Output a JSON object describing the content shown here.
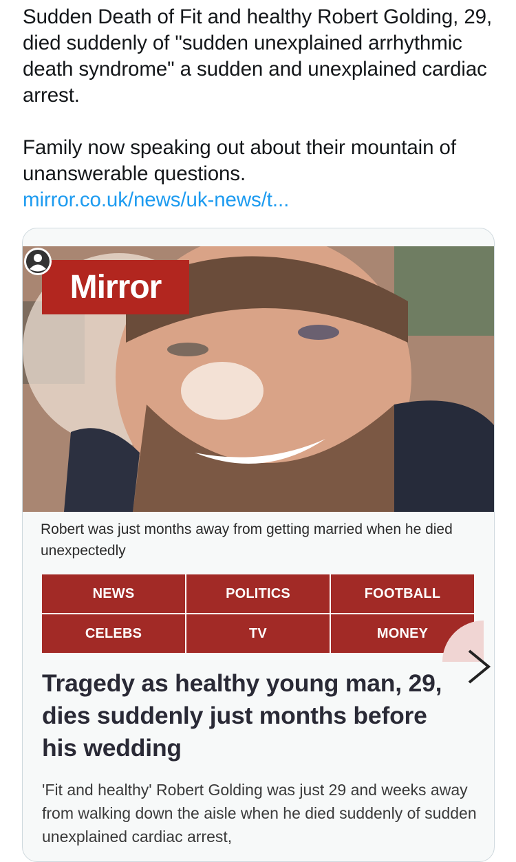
{
  "tweet": {
    "line1": "Sudden Death of Fit and healthy Robert Golding, 29, died suddenly of \"sudden unexplained arrhythmic death syndrome\" a sudden and unexplained cardiac arrest.",
    "line2": "Family now speaking out about their mountain of unanswerable questions.",
    "link": "mirror.co.uk/news/uk-news/t..."
  },
  "card": {
    "logo": "Mirror",
    "caption": "Robert was just months away from getting married when he died unexpectedly",
    "nav": [
      "NEWS",
      "POLITICS",
      "FOOTBALL",
      "CELEBS",
      "TV",
      "MONEY"
    ],
    "headline": "Tragedy as healthy young man, 29, dies suddenly just months before his wedding",
    "summary": "'Fit and healthy' Robert Golding was just 29 and weeks away from walking down the aisle when he died suddenly of sudden unexplained cardiac arrest,"
  },
  "colors": {
    "brand_red": "#b2261f",
    "nav_red": "#a22a26",
    "link_blue": "#1d9bf0"
  }
}
